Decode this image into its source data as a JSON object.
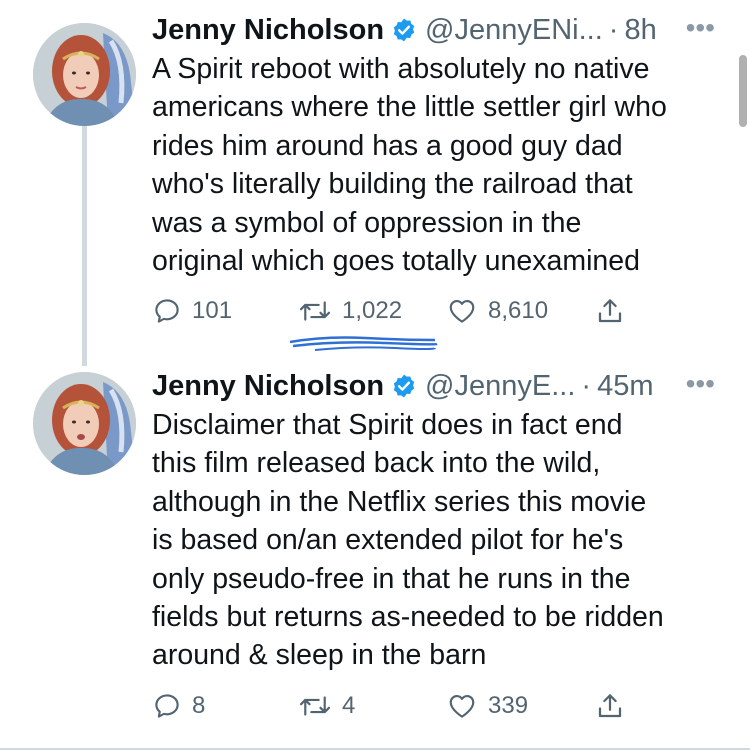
{
  "tweets": [
    {
      "name": "Jenny Nicholson",
      "handle": "@JennyENi...",
      "separator": "·",
      "time": "8h",
      "text": "A Spirit reboot with absolutely no native\namericans where the little settler girl who\nrides him around has a good guy dad\nwho's literally building the railroad that\nwas a symbol of oppression in the\noriginal which goes totally unexamined",
      "replies": "101",
      "retweets": "1,022",
      "likes": "8,610"
    },
    {
      "name": "Jenny Nicholson",
      "handle": "@JennyE...",
      "separator": "·",
      "time": "45m",
      "text": "Disclaimer that Spirit does in fact end\nthis film released back into the wild,\nalthough in the Netflix series this movie\nis based on/an extended pilot for he's\nonly pseudo-free in that he runs in the\nfields but returns as-needed to be ridden\naround & sleep in the barn",
      "replies": "8",
      "retweets": "4",
      "likes": "339"
    }
  ],
  "icons": {
    "verified": "verified-badge-icon",
    "more": "more-icon",
    "reply": "reply-icon",
    "retweet": "retweet-icon",
    "like": "like-icon",
    "share": "share-icon"
  },
  "colors": {
    "verified": "#1d9bf0",
    "text": "#0f1419",
    "muted": "#536471",
    "thread_line": "#cfd9de",
    "scribble": "#2f6fd6"
  },
  "more_glyph": "•••"
}
